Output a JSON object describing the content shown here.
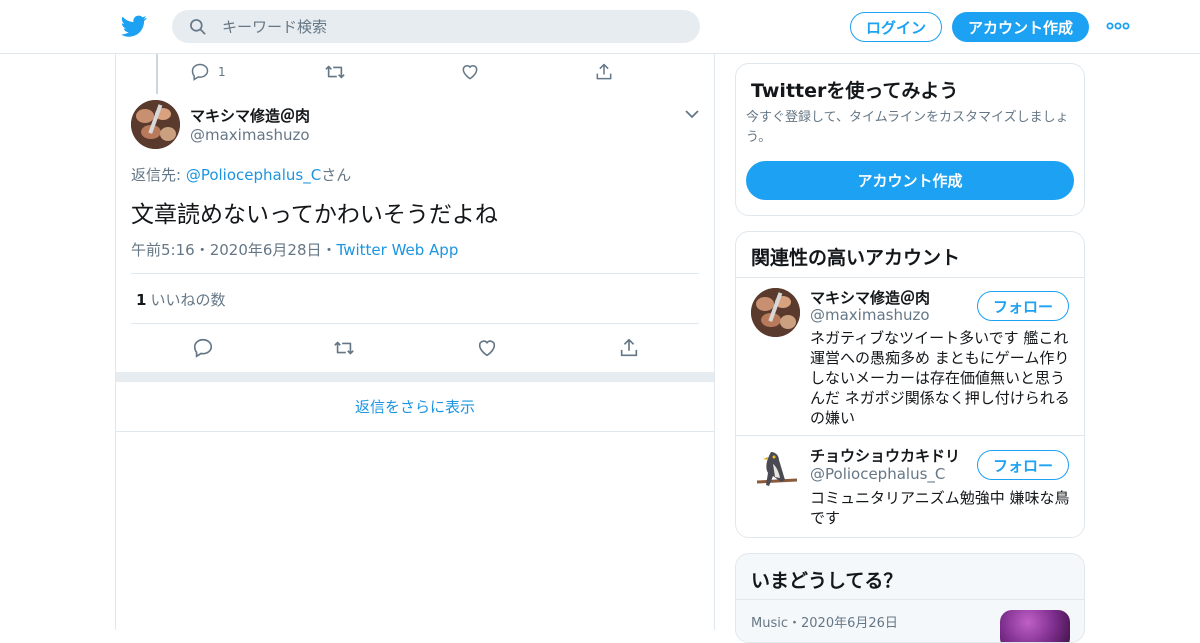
{
  "header": {
    "search_placeholder": "キーワード検索",
    "login_label": "ログイン",
    "signup_label": "アカウント作成"
  },
  "prev_tweet": {
    "reply_count": "1"
  },
  "tweet": {
    "author_name": "マキシマ修造＠肉",
    "author_handle": "@maximashuzo",
    "reply_to_prefix": "返信先: ",
    "reply_to_handle": "@Poliocephalus_C",
    "reply_to_suffix": "さん",
    "text": "文章読めないってかわいそうだよね",
    "time": "午前5:16",
    "date": "2020年6月28日",
    "source": "Twitter Web App",
    "separator": "・",
    "like_count": "1",
    "like_label": "いいねの数"
  },
  "more_replies_label": "返信をさらに表示",
  "signup_card": {
    "title": "Twitterを使ってみよう",
    "description": "今すぐ登録して、タイムラインをカスタマイズしましょう。",
    "button": "アカウント作成"
  },
  "related": {
    "title": "関連性の高いアカウント",
    "follow_label": "フォロー",
    "accounts": [
      {
        "name": "マキシマ修造＠肉",
        "handle": "@maximashuzo",
        "bio": "ネガティブなツイート多いです 艦これ運営への愚痴多め まともにゲーム作りしないメーカーは存在価値無いと思うんだ ネガポジ関係なく押し付けられるの嫌い"
      },
      {
        "name": "チョウショウカキドリ",
        "handle": "@Poliocephalus_C",
        "bio": "コミュニタリアニズム勉強中 嫌味な鳥です"
      }
    ]
  },
  "trends": {
    "title": "いまどうしてる？",
    "item_category": "Music",
    "item_separator": "・",
    "item_date": "2020年6月26日"
  },
  "colors": {
    "accent": "#1da1f2",
    "link": "#1b95e0",
    "secondary_text": "#657786",
    "border": "#e1e8ed"
  }
}
